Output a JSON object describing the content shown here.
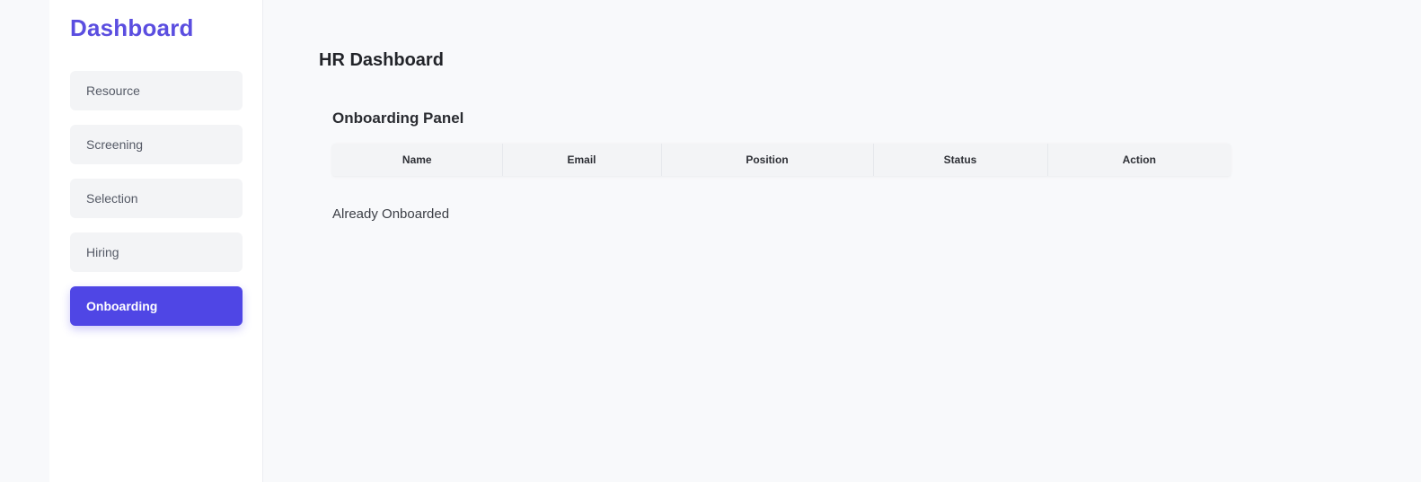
{
  "sidebar": {
    "brand": "Dashboard",
    "items": [
      {
        "label": "Resource",
        "active": false
      },
      {
        "label": "Screening",
        "active": false
      },
      {
        "label": "Selection",
        "active": false
      },
      {
        "label": "Hiring",
        "active": false
      },
      {
        "label": "Onboarding",
        "active": true
      }
    ]
  },
  "main": {
    "title": "HR Dashboard",
    "panel_title": "Onboarding Panel",
    "table": {
      "columns": [
        "Name",
        "Email",
        "Position",
        "Status",
        "Action"
      ]
    },
    "already_onboarded_label": "Already Onboarded"
  },
  "colors": {
    "accent": "#4f46e5",
    "brand": "#5b4ee0",
    "background": "#f8f9fb"
  }
}
